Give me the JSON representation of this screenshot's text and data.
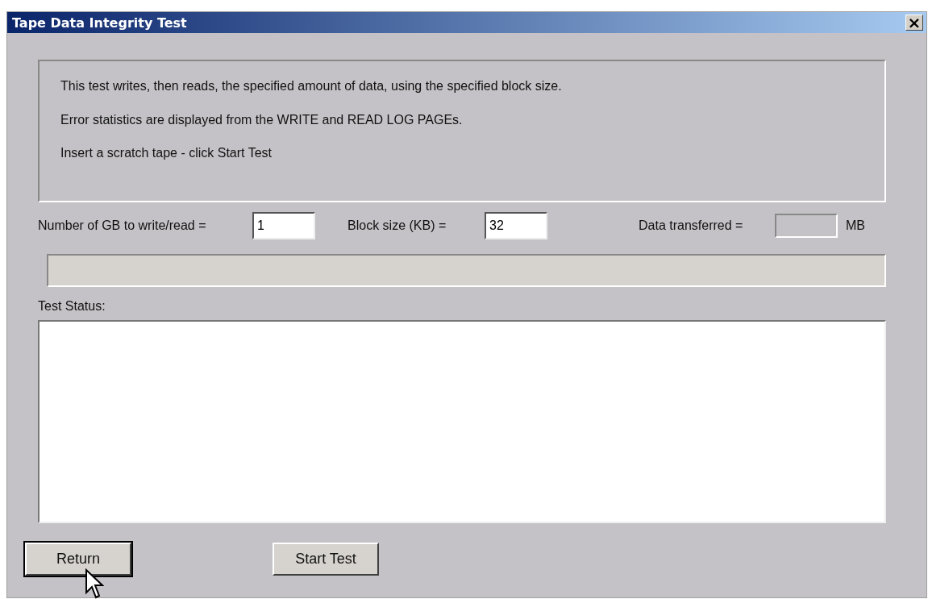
{
  "window": {
    "title": "Tape Data Integrity Test",
    "close_label": "×"
  },
  "info_lines": [
    "This test writes, then reads, the specified amount of data, using the specified block size.",
    "Error statistics are displayed from the WRITE and READ LOG PAGEs.",
    "Insert a scratch tape - click Start Test"
  ],
  "fields": [
    {
      "label": "Number of GB to write/read =",
      "value": "1",
      "disabled": false
    },
    {
      "label": "Block size (KB)  =",
      "value": "32",
      "disabled": false
    },
    {
      "label": "Data transferred  =",
      "disabled": true,
      "unit": "MB"
    }
  ],
  "progress": {
    "level": 0
  },
  "status": {
    "label": "Test Status:"
  },
  "buttons": [
    {
      "label": "Return",
      "default": true
    },
    {
      "label": "Start Test",
      "default": false
    }
  ]
}
